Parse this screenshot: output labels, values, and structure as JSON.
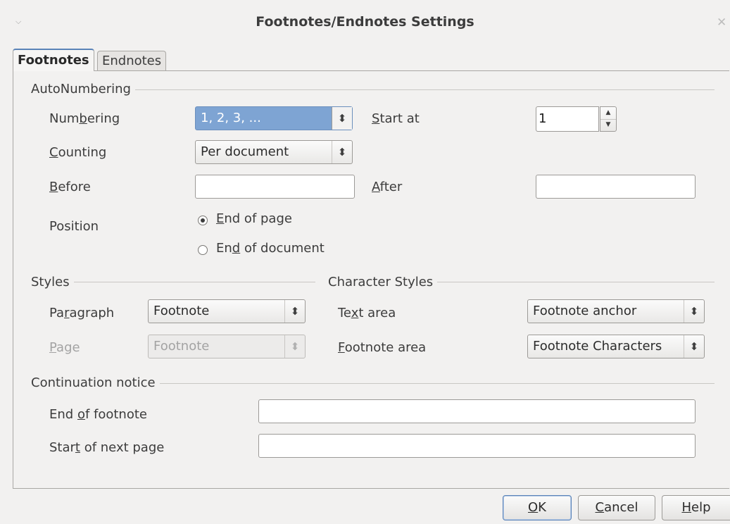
{
  "window": {
    "title": "Footnotes/Endnotes Settings",
    "icon": "window-menu-icon",
    "close": "close-icon"
  },
  "tabs": [
    {
      "label": "Footnotes",
      "active": true
    },
    {
      "label": "Endnotes",
      "active": false
    }
  ],
  "autonumbering": {
    "header": "AutoNumbering",
    "numbering_label_pre": "Num",
    "numbering_label_u": "b",
    "numbering_label_post": "ering",
    "numbering_value": "1, 2, 3, ...",
    "start_label_u": "S",
    "start_label_post": "tart at",
    "start_value": "1",
    "counting_label_u": "C",
    "counting_label_post": "ounting",
    "counting_value": "Per document",
    "before_label_u": "B",
    "before_label_post": "efore",
    "before_value": "",
    "after_label_u": "A",
    "after_label_post": "fter",
    "after_value": "",
    "position_label": "Position",
    "position_options": [
      {
        "pre": "",
        "u": "E",
        "post": "nd of page",
        "selected": true
      },
      {
        "pre": "En",
        "u": "d",
        "post": " of document",
        "selected": false
      }
    ]
  },
  "styles": {
    "header": "Styles",
    "paragraph_label_pre": "Pa",
    "paragraph_label_u": "r",
    "paragraph_label_post": "agraph",
    "paragraph_value": "Footnote",
    "page_label_u": "P",
    "page_label_post": "age",
    "page_value": "Footnote"
  },
  "character_styles": {
    "header": "Character Styles",
    "text_area_label_pre": "Te",
    "text_area_label_u": "x",
    "text_area_label_post": "t area",
    "text_area_value": "Footnote anchor",
    "footnote_area_label_u": "F",
    "footnote_area_label_post": "ootnote area",
    "footnote_area_value": "Footnote Characters"
  },
  "continuation": {
    "header": "Continuation notice",
    "end_label_pre": "End ",
    "end_label_u": "o",
    "end_label_post": "f footnote",
    "end_value": "",
    "start_label_pre": "Star",
    "start_label_u": "t",
    "start_label_post": " of next page",
    "start_value": ""
  },
  "buttons": {
    "ok_u": "O",
    "ok_post": "K",
    "cancel_u": "C",
    "cancel_post": "ancel",
    "help_u": "H",
    "help_post": "elp"
  },
  "colors": {
    "selection": "#7ea4d3",
    "background": "#f2f1f0",
    "focus": "#5a83b8"
  }
}
